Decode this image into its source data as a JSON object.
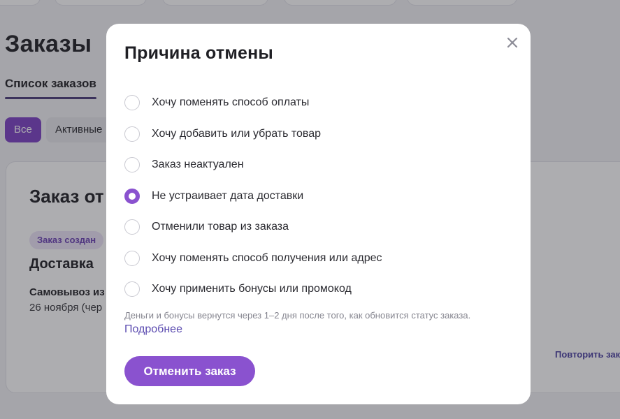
{
  "background": {
    "page_title": "Заказы",
    "subtab": "Список заказов",
    "filters": [
      "Все",
      "Активные"
    ],
    "order_title": "Заказ от",
    "status_badge": "Заказ создан",
    "delivery_title": "Доставка",
    "pickup_line": "Самовывоз из",
    "date_line": "26 ноября (чер",
    "repeat_link": "Повторить зака"
  },
  "modal": {
    "title": "Причина отмены",
    "close_icon": "close-icon",
    "reasons": [
      {
        "label": "Хочу поменять способ оплаты",
        "checked": false
      },
      {
        "label": "Хочу добавить или убрать товар",
        "checked": false
      },
      {
        "label": "Заказ неактуален",
        "checked": false
      },
      {
        "label": "Не устраивает дата доставки",
        "checked": true
      },
      {
        "label": "Отменили товар из заказа",
        "checked": false
      },
      {
        "label": "Хочу поменять способ получения или адрес",
        "checked": false
      },
      {
        "label": "Хочу применить бонусы или промокод",
        "checked": false
      }
    ],
    "info_text": "Деньги и бонусы вернутся через 1–2 дня после того, как обновится статус заказа.",
    "more_link": "Подробнее",
    "cancel_button": "Отменить заказ"
  },
  "colors": {
    "accent": "#8a52cf",
    "accent_dark": "#7b3fc4",
    "link": "#5b4bb0"
  }
}
